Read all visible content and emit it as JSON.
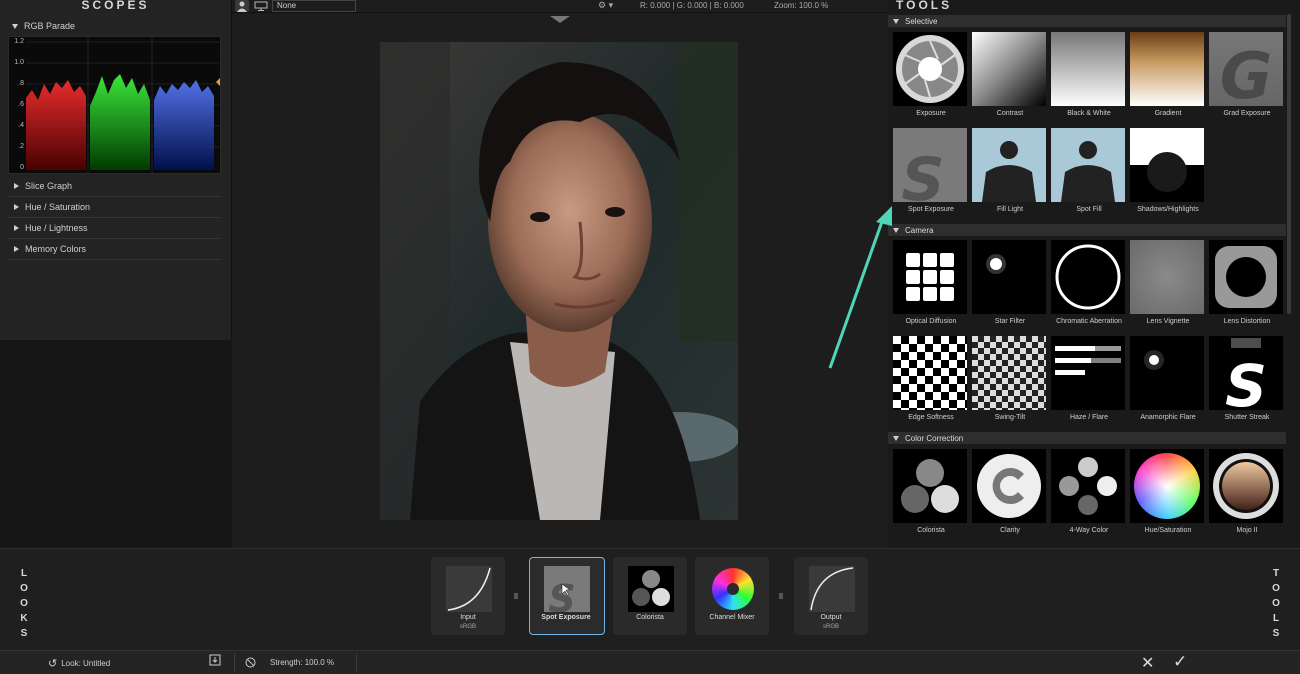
{
  "scopes": {
    "title": "SCOPES",
    "parade_label": "RGB Parade",
    "y_ticks": [
      "1.2",
      "1.0",
      ".8",
      ".6",
      ".4",
      ".2",
      "0"
    ],
    "rows": [
      "Slice Graph",
      "Hue / Saturation",
      "Hue / Lightness",
      "Memory Colors"
    ]
  },
  "viewer_top": {
    "preset": "None",
    "readout": "R: 0.000  |  G: 0.000  |  B: 0.000",
    "zoom": "Zoom: 100.0 %"
  },
  "tools": {
    "title": "TOOLS",
    "categories": [
      {
        "name": "Selective",
        "items": [
          "Exposure",
          "Contrast",
          "Black & White",
          "Gradient",
          "Grad Exposure",
          "Spot Exposure",
          "Fill Light",
          "Spot Fill",
          "Shadows/Highlights"
        ]
      },
      {
        "name": "Camera",
        "items": [
          "Optical Diffusion",
          "Star Filter",
          "Chromatic Aberration",
          "Lens Vignette",
          "Lens Distortion",
          "Edge Softness",
          "Swing-Tilt",
          "Haze / Flare",
          "Anamorphic Flare",
          "Shutter Streak"
        ]
      },
      {
        "name": "Color Correction",
        "items": [
          "Colorista",
          "Clarity",
          "4-Way Color",
          "Hue/Saturation",
          "Mojo II"
        ]
      }
    ]
  },
  "pipeline": {
    "looks_label": [
      "L",
      "O",
      "O",
      "K",
      "S"
    ],
    "tools_label": [
      "T",
      "O",
      "O",
      "L",
      "S"
    ],
    "nodes": [
      {
        "label": "Input",
        "sub": "sRGB"
      },
      {
        "label": "Spot Exposure",
        "sub": ""
      },
      {
        "label": "Colorista",
        "sub": ""
      },
      {
        "label": "Channel Mixer",
        "sub": ""
      },
      {
        "label": "Output",
        "sub": "sRGB"
      }
    ]
  },
  "status": {
    "look": "Look:  Untitled",
    "strength": "Strength: 100.0 %"
  },
  "colors": {
    "accent": "#6fb6e6",
    "arrow": "#4fd6b8"
  }
}
